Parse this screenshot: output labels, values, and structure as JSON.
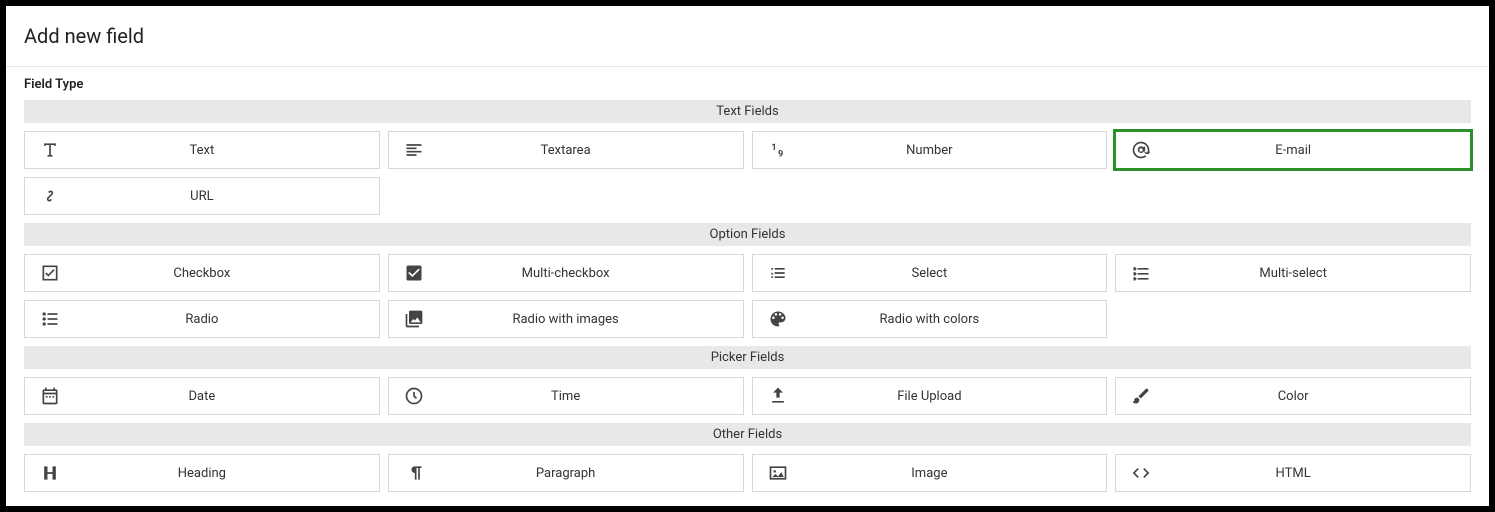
{
  "title": "Add new field",
  "field_type_label": "Field Type",
  "groups": {
    "text": {
      "header": "Text Fields",
      "items": {
        "text": "Text",
        "textarea": "Textarea",
        "number": "Number",
        "email": "E-mail",
        "url": "URL"
      }
    },
    "option": {
      "header": "Option Fields",
      "items": {
        "checkbox": "Checkbox",
        "multicheckbox": "Multi-checkbox",
        "select": "Select",
        "multiselect": "Multi-select",
        "radio": "Radio",
        "radio_images": "Radio with images",
        "radio_colors": "Radio with colors"
      }
    },
    "picker": {
      "header": "Picker Fields",
      "items": {
        "date": "Date",
        "time": "Time",
        "file": "File Upload",
        "color": "Color"
      }
    },
    "other": {
      "header": "Other Fields",
      "items": {
        "heading": "Heading",
        "paragraph": "Paragraph",
        "image": "Image",
        "html": "HTML"
      }
    }
  },
  "selected": "email"
}
